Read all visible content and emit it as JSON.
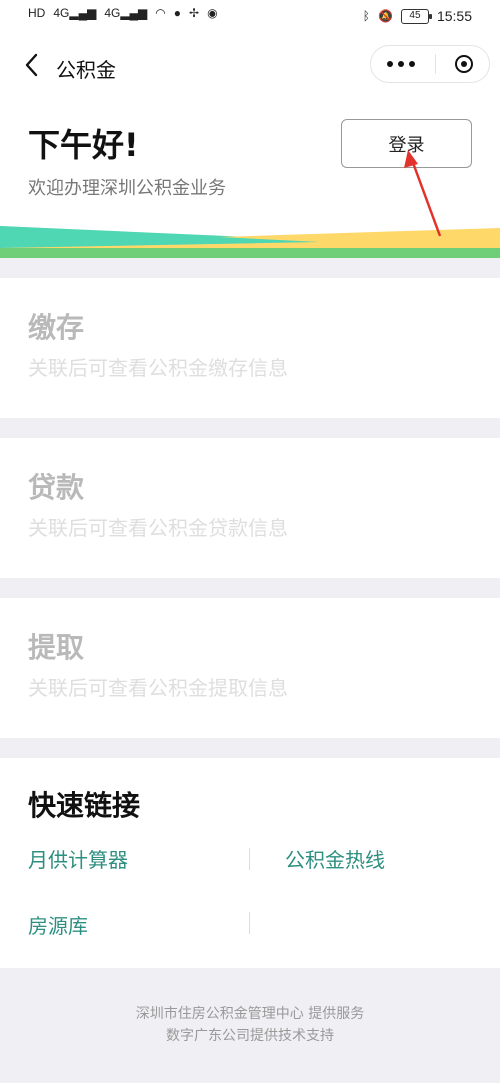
{
  "status_bar": {
    "left_icons": [
      "HD",
      "4G",
      "4G",
      "wifi",
      "bubble",
      "pinwheel",
      "browser"
    ],
    "battery": "45",
    "time": "15:55"
  },
  "nav": {
    "title": "公积金"
  },
  "hero": {
    "greeting": "下午好!",
    "subtitle": "欢迎办理深圳公积金业务",
    "login_label": "登录"
  },
  "cards": [
    {
      "title": "缴存",
      "desc": "关联后可查看公积金缴存信息"
    },
    {
      "title": "贷款",
      "desc": "关联后可查看公积金贷款信息"
    },
    {
      "title": "提取",
      "desc": "关联后可查看公积金提取信息"
    }
  ],
  "quick_links": {
    "title": "快速链接",
    "items": [
      "月供计算器",
      "公积金热线",
      "房源库"
    ]
  },
  "footer": {
    "line1": "深圳市住房公积金管理中心 提供服务",
    "line2": "数字广东公司提供技术支持"
  },
  "colors": {
    "link": "#2e8f80",
    "wave_teal": "#4fd6b2",
    "wave_green": "#6fcf79",
    "wave_yellow": "#ffd86a",
    "arrow": "#e2322c"
  }
}
